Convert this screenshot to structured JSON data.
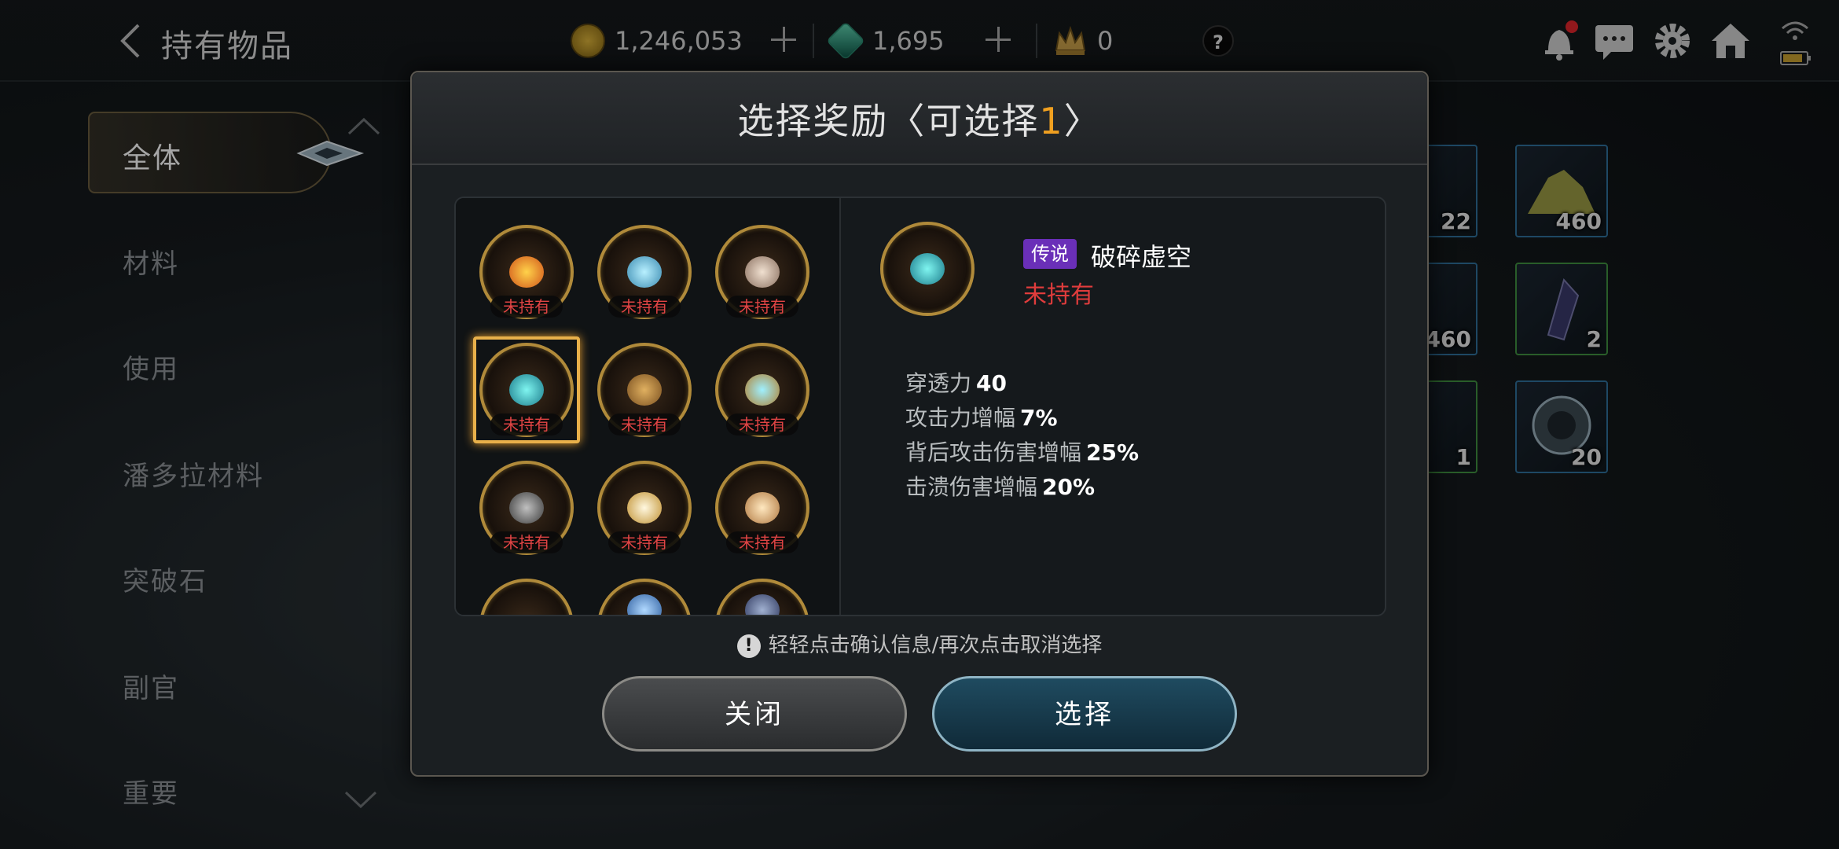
{
  "header": {
    "title": "持有物品",
    "gold": "1,246,053",
    "gems": "1,695",
    "crowns": "0",
    "help_label": "?"
  },
  "sidebar": {
    "items": [
      {
        "label": "全体",
        "active": true
      },
      {
        "label": "材料"
      },
      {
        "label": "使用"
      },
      {
        "label": "潘多拉材料"
      },
      {
        "label": "突破石"
      },
      {
        "label": "副官"
      },
      {
        "label": "重要"
      }
    ]
  },
  "inventory_counts": [
    "22",
    "460",
    "460",
    "2",
    "1",
    "20"
  ],
  "modal": {
    "title_prefix": "选择奖励〈可选择",
    "title_count": "1",
    "title_suffix": "〉",
    "reward_tag": "未持有",
    "detail": {
      "rarity": "传说",
      "name": "破碎虚空",
      "status": "未持有",
      "stats": [
        {
          "label": "穿透力",
          "value": "40"
        },
        {
          "label": "攻击力增幅",
          "value": "7%"
        },
        {
          "label": "背后攻击伤害增幅",
          "value": "25%"
        },
        {
          "label": "击溃伤害增幅",
          "value": "20%"
        }
      ]
    },
    "hint": "轻轻点击确认信息/再次点击取消选择",
    "hint_icon": "!",
    "close_label": "关闭",
    "select_label": "选择"
  },
  "colors": {
    "accent_gold": "#f0a020",
    "not_owned_red": "#e03c3c",
    "legendary_purple": "#6a2fb8"
  }
}
